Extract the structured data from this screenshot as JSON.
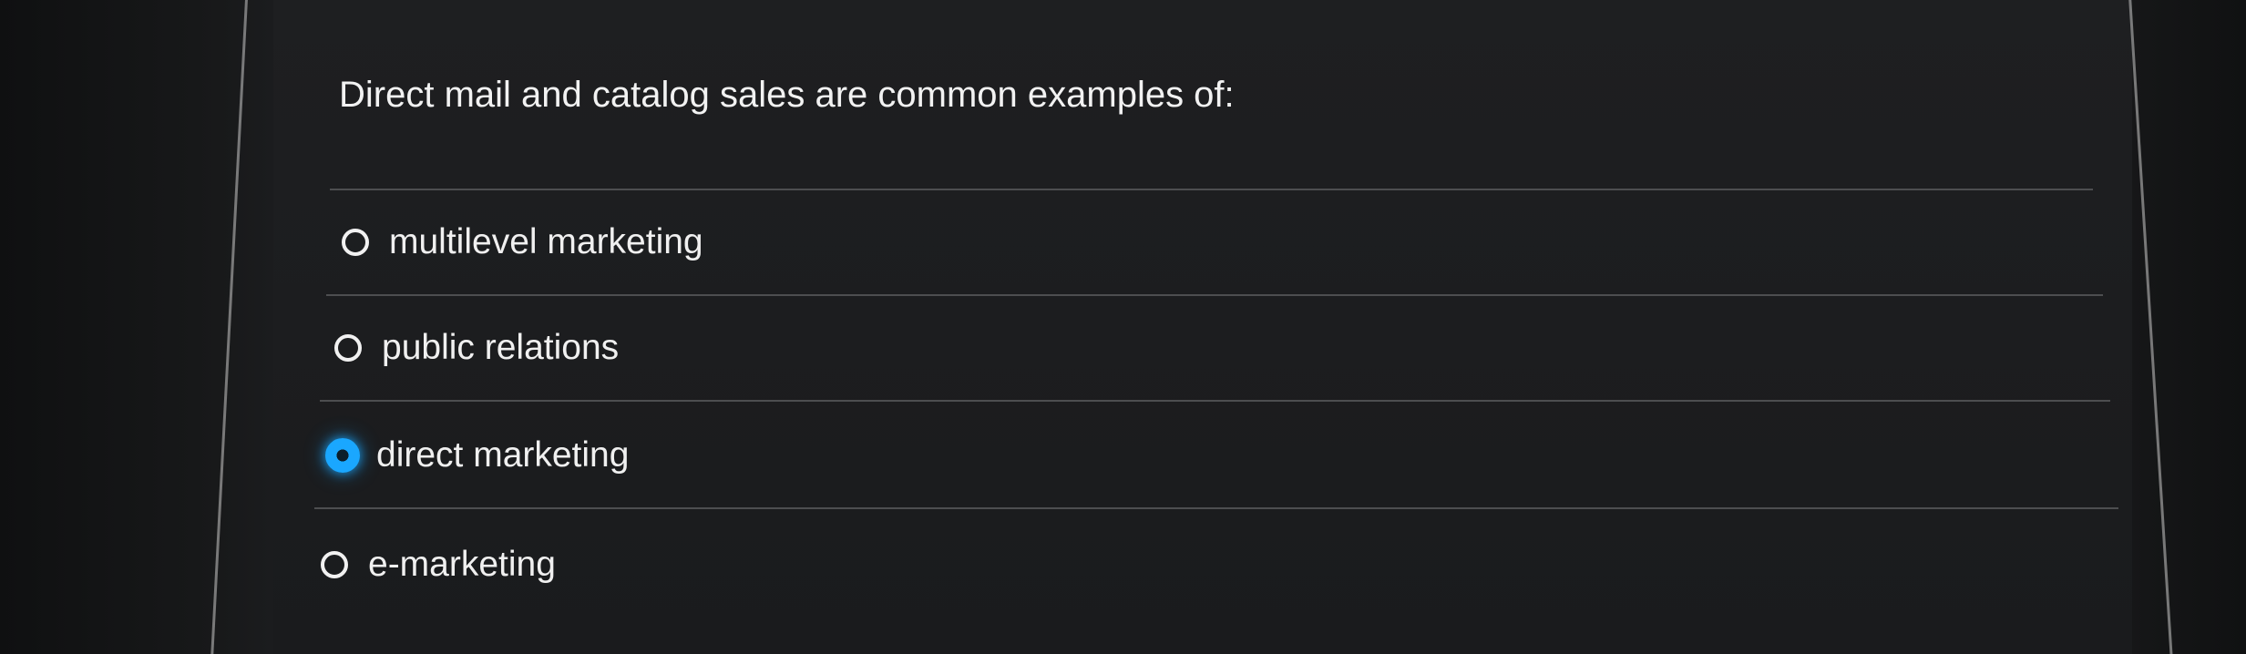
{
  "question": {
    "text": "Direct mail and catalog sales are common examples of:"
  },
  "options": [
    {
      "label": "multilevel marketing",
      "selected": false
    },
    {
      "label": "public relations",
      "selected": false
    },
    {
      "label": "direct marketing",
      "selected": true
    },
    {
      "label": "e-marketing",
      "selected": false
    }
  ],
  "colors": {
    "background": "#1b1c1e",
    "text": "#f0f0f0",
    "divider": "#4d4e50",
    "selected_accent": "#1aa7ff"
  }
}
